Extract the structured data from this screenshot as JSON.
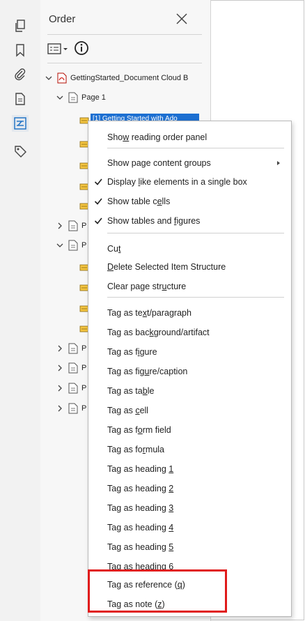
{
  "panel": {
    "title": "Order",
    "close_icon": "close-icon",
    "options_icon": "options-menu-icon",
    "info_icon": "info-icon"
  },
  "toolstrip": {
    "tools": [
      {
        "name": "pages-icon"
      },
      {
        "name": "bookmark-icon"
      },
      {
        "name": "attachment-icon"
      },
      {
        "name": "content-icon"
      },
      {
        "name": "order-icon"
      },
      {
        "name": "tags-icon"
      }
    ]
  },
  "tree": {
    "document_label": "GettingStarted_Document Cloud B",
    "page1_label": "Page 1",
    "selected_item_label": "[1] Getting Started with Ado",
    "collapsed_pages_prefix": "P"
  },
  "menu": {
    "items": [
      {
        "pre": "Sho",
        "u": "w",
        "post": " reading order panel",
        "checked": false,
        "submenu": false
      },
      {
        "pre": "Show page content ",
        "u": "g",
        "post": "roups",
        "checked": false,
        "submenu": true
      },
      {
        "pre": "Display ",
        "u": "l",
        "post": "ike elements in a single box",
        "checked": true,
        "submenu": false
      },
      {
        "pre": "Show table c",
        "u": "e",
        "post": "lls",
        "checked": true,
        "submenu": false
      },
      {
        "pre": "Show tables and ",
        "u": "f",
        "post": "igures",
        "checked": true,
        "submenu": false
      },
      {
        "pre": "Cu",
        "u": "t",
        "post": "",
        "checked": false,
        "submenu": false
      },
      {
        "pre": "",
        "u": "D",
        "post": "elete Selected Item Structure",
        "checked": false,
        "submenu": false
      },
      {
        "pre": "Clear page str",
        "u": "u",
        "post": "cture",
        "checked": false,
        "submenu": false
      },
      {
        "pre": "Tag as te",
        "u": "x",
        "post": "t/paragraph",
        "checked": false,
        "submenu": false
      },
      {
        "pre": "Tag as bac",
        "u": "k",
        "post": "ground/artifact",
        "checked": false,
        "submenu": false
      },
      {
        "pre": "Tag as f",
        "u": "i",
        "post": "gure",
        "checked": false,
        "submenu": false
      },
      {
        "pre": "Tag as fig",
        "u": "u",
        "post": "re/caption",
        "checked": false,
        "submenu": false
      },
      {
        "pre": "Tag as ta",
        "u": "b",
        "post": "le",
        "checked": false,
        "submenu": false
      },
      {
        "pre": "Tag as ",
        "u": "c",
        "post": "ell",
        "checked": false,
        "submenu": false
      },
      {
        "pre": "Tag as f",
        "u": "o",
        "post": "rm field",
        "checked": false,
        "submenu": false
      },
      {
        "pre": "Tag as fo",
        "u": "r",
        "post": "mula",
        "checked": false,
        "submenu": false
      },
      {
        "pre": "Tag as heading ",
        "u": "1",
        "post": "",
        "checked": false,
        "submenu": false
      },
      {
        "pre": "Tag as heading ",
        "u": "2",
        "post": "",
        "checked": false,
        "submenu": false
      },
      {
        "pre": "Tag as heading ",
        "u": "3",
        "post": "",
        "checked": false,
        "submenu": false
      },
      {
        "pre": "Tag as heading ",
        "u": "4",
        "post": "",
        "checked": false,
        "submenu": false
      },
      {
        "pre": "Tag as heading ",
        "u": "5",
        "post": "",
        "checked": false,
        "submenu": false
      },
      {
        "pre": "Tag as heading ",
        "u": "6",
        "post": "",
        "checked": false,
        "submenu": false
      },
      {
        "pre": "Tag as reference (",
        "u": "q",
        "post": ")",
        "checked": false,
        "submenu": false
      },
      {
        "pre": "Tag as note (",
        "u": "z",
        "post": ")",
        "checked": false,
        "submenu": false
      }
    ]
  },
  "colors": {
    "highlight": "#e01b1b",
    "selection": "#1c6fd1",
    "toolbar_active": "#1a6fc4"
  }
}
